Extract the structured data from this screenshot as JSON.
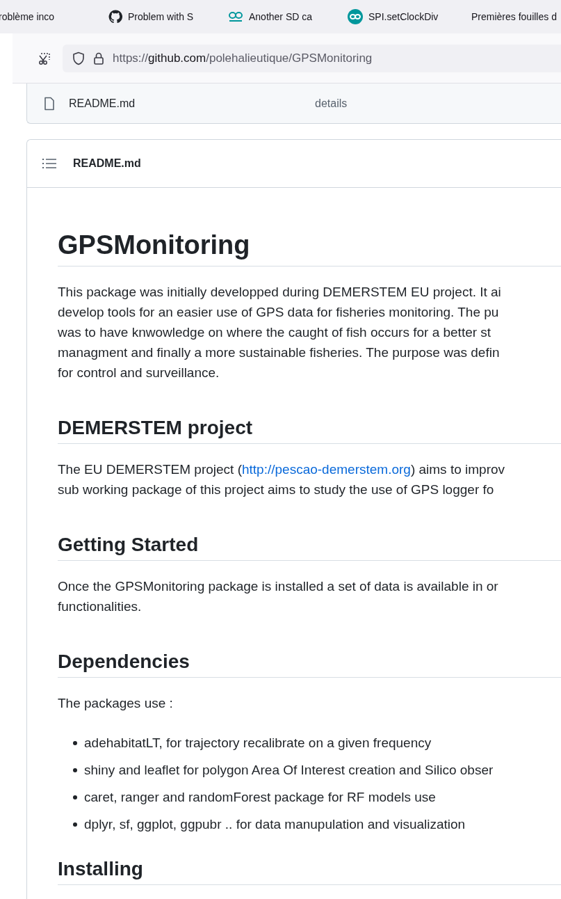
{
  "browser": {
    "tabs": [
      {
        "title": "roblème inco",
        "kind": "plain"
      },
      {
        "title": "Problem with S",
        "kind": "cat"
      },
      {
        "title": "Another SD ca",
        "kind": "loop"
      },
      {
        "title": "SPI.setClockDiv",
        "kind": "loopdisc"
      },
      {
        "title": "Premières fouilles d",
        "kind": "plain"
      }
    ],
    "address": {
      "prefix": "https://",
      "host": "github.com",
      "path": "/polehalieutique/GPSMonitoring"
    }
  },
  "file_row": {
    "name": "README.md",
    "message": "details"
  },
  "readme": {
    "title": "README.md",
    "blocks": [
      {
        "kind": "h1",
        "text": "GPSMonitoring"
      },
      {
        "kind": "p",
        "lines": [
          "This package was initially developped during DEMERSTEM EU project. It ai",
          "develop tools for an easier use of GPS data for fisheries monitoring. The pu",
          "was to have knwowledge on where the caught of fish occurs for a better st",
          "managment and finally a more sustainable fisheries. The purpose was defin",
          "for control and surveillance."
        ]
      },
      {
        "kind": "h2",
        "text": "DEMERSTEM project"
      },
      {
        "kind": "p",
        "lines": [
          [
            {
              "text": "The EU DEMERSTEM project ("
            },
            {
              "text": "http://pescao-demerstem.org",
              "link": true
            },
            {
              "text": ") aims to improv"
            }
          ],
          "sub working package of this project aims to study the use of GPS logger fo"
        ]
      },
      {
        "kind": "h2",
        "text": "Getting Started"
      },
      {
        "kind": "p",
        "lines": [
          "Once the GPSMonitoring package is installed a set of data is available in or",
          "functionalities."
        ]
      },
      {
        "kind": "h2",
        "text": "Dependencies"
      },
      {
        "kind": "p",
        "lines": [
          "The packages use :"
        ]
      },
      {
        "kind": "ul",
        "items": [
          "adehabitatLT, for trajectory recalibrate on a given frequency",
          "shiny and leaflet for polygon Area Of Interest creation and Silico obser",
          "caret, ranger and randomForest package for RF models use",
          "dplyr, sf, ggplot, ggpubr .. for data manupulation and visualization"
        ]
      },
      {
        "kind": "h2",
        "text": "Installing"
      }
    ]
  }
}
